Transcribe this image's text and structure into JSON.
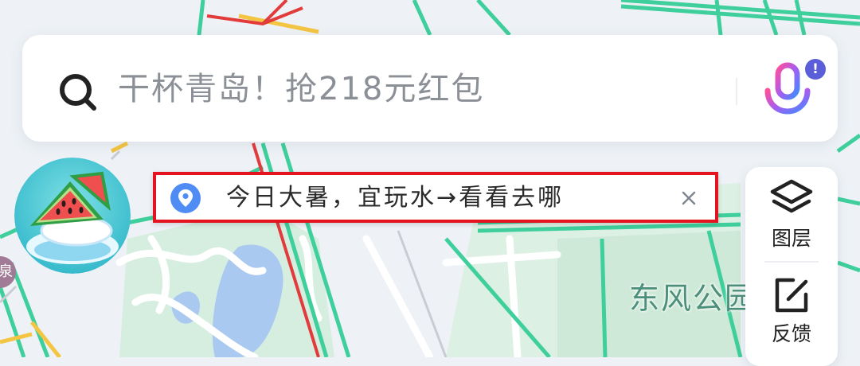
{
  "map": {
    "place_label": "东风公园",
    "edge_badge": "泉"
  },
  "search": {
    "placeholder": "干杯青岛！抢218元红包",
    "mic_badge": "!"
  },
  "promo": {
    "text": "今日大暑，宜玩水→看看去哪",
    "close_symbol": "×"
  },
  "tools": [
    {
      "label": "图层",
      "icon": "layers-icon"
    },
    {
      "label": "反馈",
      "icon": "feedback-icon"
    }
  ],
  "colors": {
    "road_green": "#3fcf9c",
    "road_red": "#e23b3b",
    "road_yellow": "#f4c542",
    "park_green": "#cdebd9",
    "water_blue": "#aacbf2",
    "highlight_red": "#e3131f",
    "pin_blue": "#4f8df5"
  }
}
